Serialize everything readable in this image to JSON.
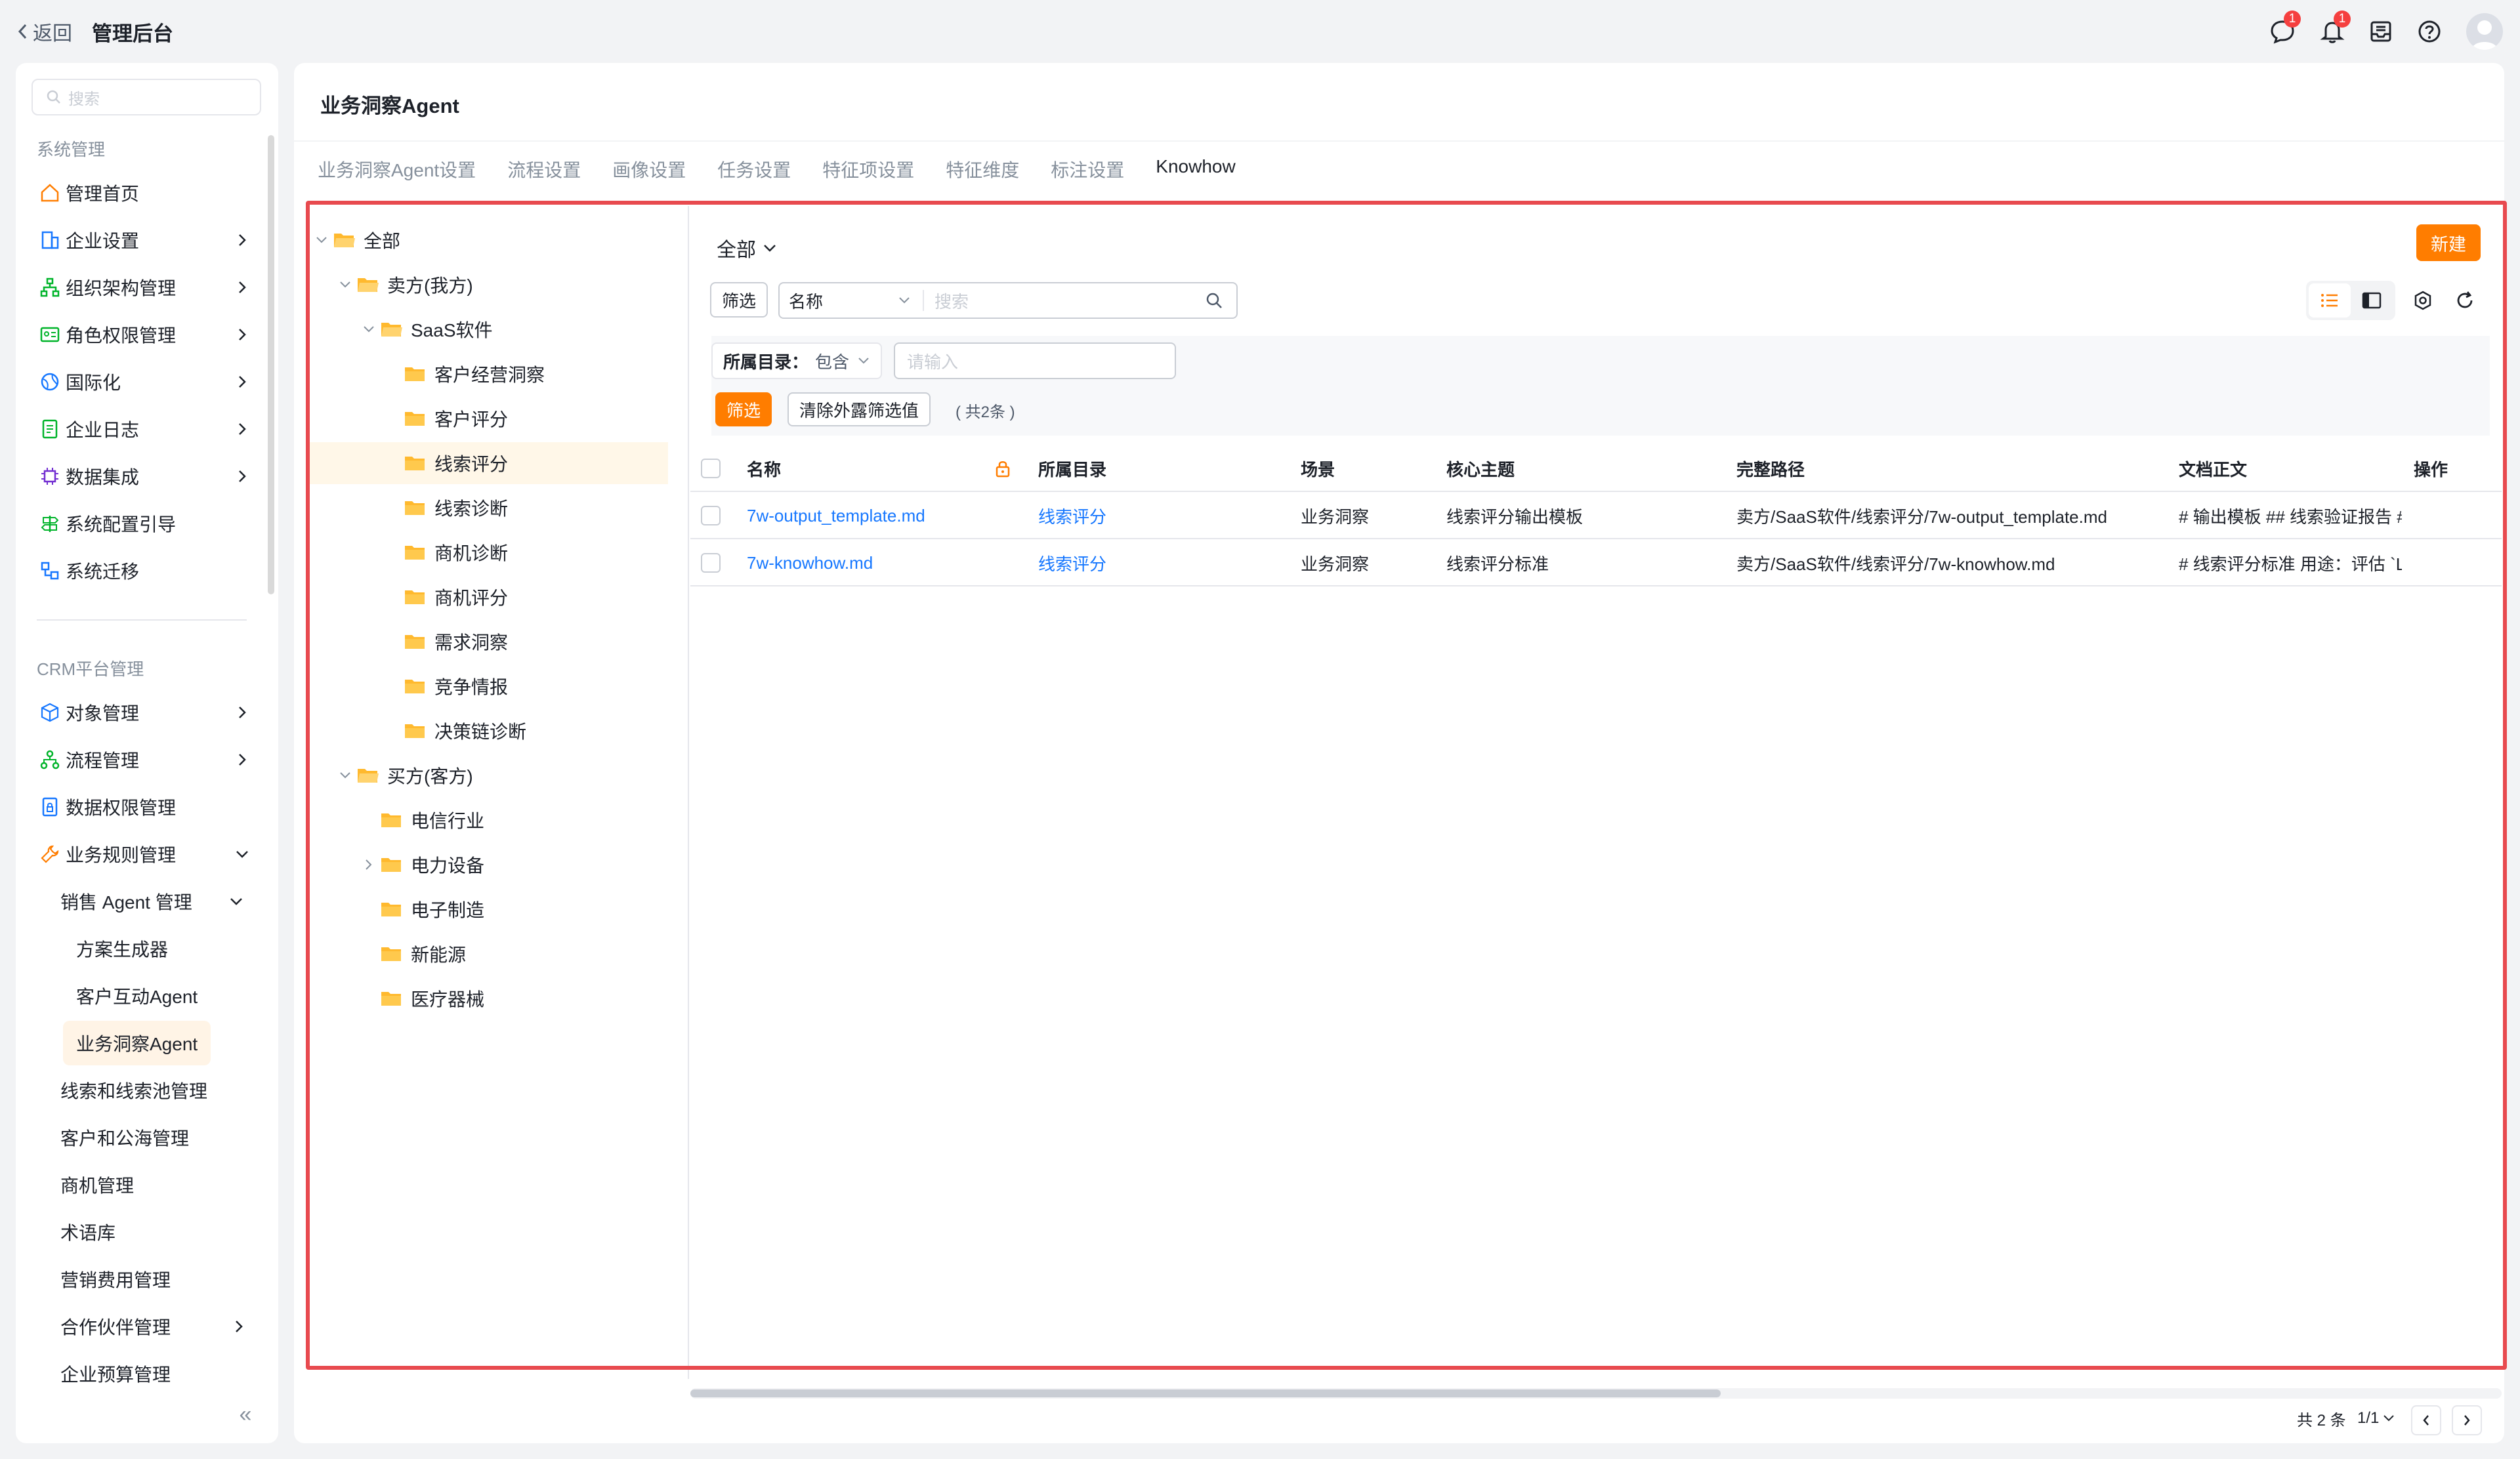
{
  "header": {
    "back_label": "返回",
    "app_title": "管理后台",
    "chat_badge": "1",
    "bell_badge": "1"
  },
  "sidebar": {
    "search_placeholder": "搜索",
    "section_system": "系统管理",
    "system_items": [
      "管理首页",
      "企业设置",
      "组织架构管理",
      "角色权限管理",
      "国际化",
      "企业日志",
      "数据集成",
      "系统配置引导",
      "系统迁移"
    ],
    "section_crm": "CRM平台管理",
    "crm_items": [
      "对象管理",
      "流程管理",
      "数据权限管理",
      "业务规则管理"
    ],
    "sales_agent_group": "销售 Agent 管理",
    "sales_agent_items": [
      "方案生成器",
      "客户互动Agent",
      "业务洞察Agent"
    ],
    "more_items": [
      "线索和线索池管理",
      "客户和公海管理",
      "商机管理",
      "术语库",
      "营销费用管理",
      "合作伙伴管理",
      "企业预算管理"
    ],
    "collapse_icon": "«"
  },
  "main": {
    "title": "业务洞察Agent",
    "tabs": [
      "业务洞察Agent设置",
      "流程设置",
      "画像设置",
      "任务设置",
      "特征项设置",
      "特征维度",
      "标注设置",
      "Knowhow"
    ],
    "active_tab": "Knowhow"
  },
  "tree": {
    "root": "全部",
    "seller": "卖方(我方)",
    "saas": "SaaS软件",
    "saas_children": [
      "客户经营洞察",
      "客户评分",
      "线索评分",
      "线索诊断",
      "商机诊断",
      "商机评分",
      "需求洞察",
      "竞争情报",
      "决策链诊断"
    ],
    "selected": "线索评分",
    "buyer": "买方(客方)",
    "buyer_children": [
      "电信行业",
      "电力设备",
      "电子制造",
      "新能源",
      "医疗器械"
    ]
  },
  "content": {
    "scope_label": "全部",
    "new_button": "新建",
    "filter_button": "筛选",
    "search_field": "名称",
    "search_placeholder": "搜索",
    "condition_key": "所属目录：",
    "condition_op": "包含",
    "condition_placeholder": "请输入",
    "apply_filter": "筛选",
    "clear_filter": "清除外露筛选值",
    "count_text": "( 共2条 )"
  },
  "table": {
    "columns": [
      "名称",
      "所属目录",
      "场景",
      "核心主题",
      "完整路径",
      "文档正文",
      "操作"
    ],
    "rows": [
      {
        "name": "7w-output_template.md",
        "dir": "线索评分",
        "scene": "业务洞察",
        "topic": "线索评分输出模板",
        "path": "卖方/SaaS软件/线索评分/7w-output_template.md",
        "body": "# 输出模板 ## 线索验证报告 #"
      },
      {
        "name": "7w-knowhow.md",
        "dir": "线索评分",
        "scene": "业务洞察",
        "topic": "线索评分标准",
        "path": "卖方/SaaS软件/线索评分/7w-knowhow.md",
        "body": "# 线索评分标准 用途：评估 `L"
      }
    ]
  },
  "pagination": {
    "total": "共 2 条",
    "page": "1/1"
  },
  "colors": {
    "accent": "#ff7d00",
    "link": "#1677ff",
    "highlight": "#e84a4f",
    "folder": "#ffb92e"
  }
}
